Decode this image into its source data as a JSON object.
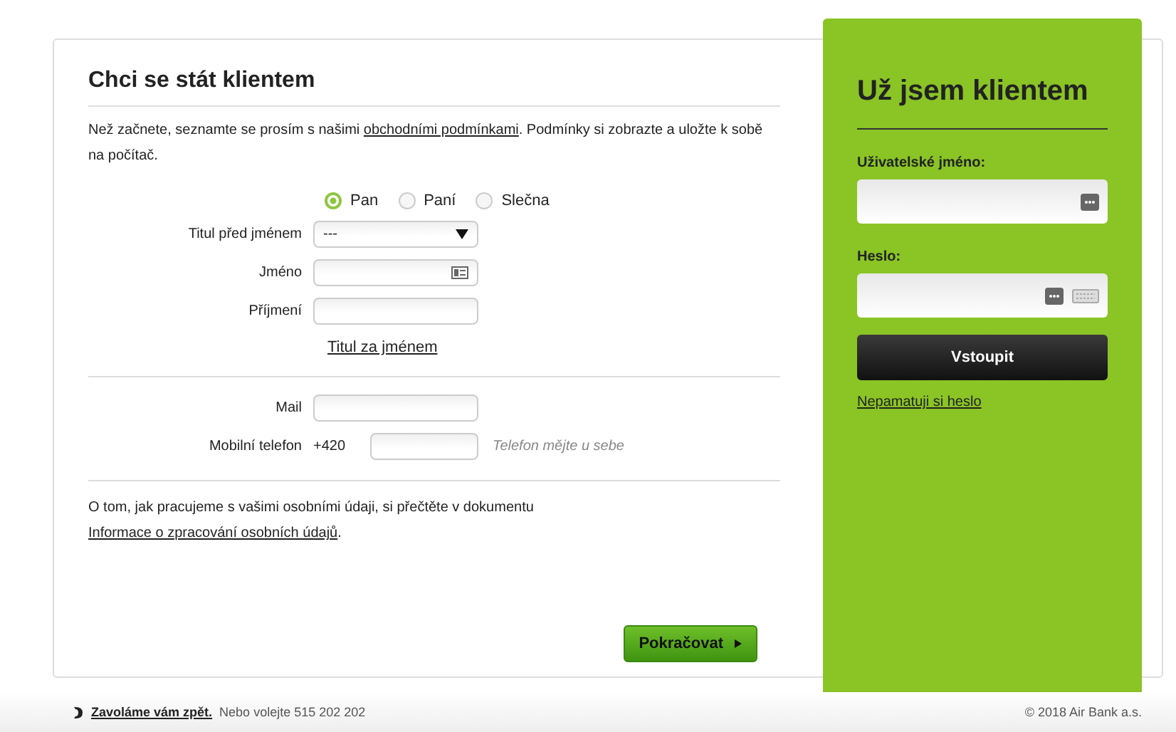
{
  "register": {
    "title": "Chci se stát klientem",
    "intro": {
      "before": "Než začnete, seznamte se prosím s našimi ",
      "link": "obchodními podmínkami",
      "after": ". Podmínky si zobrazte a uložte k sobě na počítač."
    },
    "salutations": [
      {
        "label": "Pan",
        "selected": true
      },
      {
        "label": "Paní",
        "selected": false
      },
      {
        "label": "Slečna",
        "selected": false
      }
    ],
    "title_before": {
      "label": "Titul před jménem",
      "value": "---"
    },
    "first_name": {
      "label": "Jméno"
    },
    "last_name": {
      "label": "Příjmení"
    },
    "title_after_link": "Titul za jménem",
    "mail": {
      "label": "Mail"
    },
    "phone": {
      "label": "Mobilní telefon",
      "prefix": "+420",
      "hint": "Telefon mějte u sebe"
    },
    "privacy": {
      "before": "O tom, jak pracujeme s vašimi osobními údaji, si přečtěte v dokumentu ",
      "link": "Informace o zpracování osobních údajů",
      "after": "."
    },
    "continue_button": "Pokračovat"
  },
  "login": {
    "title": "Už jsem klientem",
    "username_label": "Uživatelské jméno:",
    "password_label": "Heslo:",
    "submit": "Vstoupit",
    "forgot_link": "Nepamatuji si heslo"
  },
  "footer": {
    "callback_link": "Zavoláme vám zpět.",
    "call_text": "Nebo volejte 515 202 202",
    "copyright": "© 2018 Air Bank a.s."
  }
}
